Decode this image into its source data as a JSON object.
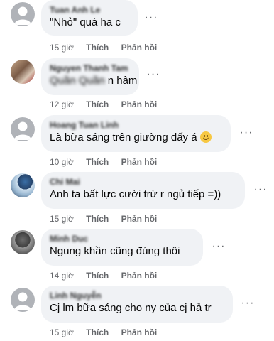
{
  "comments": [
    {
      "author": "Tuan Anh Le",
      "text": "\"Nhỏ\" quá ha c",
      "time": "15 giờ",
      "like": "Thích",
      "reply": "Phản hồi",
      "avatar": "default-avatar"
    },
    {
      "author": "Nguyen Thanh Tam",
      "text_prefix": "Quần Quần",
      "text": "n hâm",
      "time": "12 giờ",
      "like": "Thích",
      "reply": "Phản hồi",
      "avatar": "photo-avatar"
    },
    {
      "author": "Hoang Tuan Linh",
      "text": "Là bữa sáng trên giường đấy á",
      "emoji": "smiling-face-icon",
      "time": "10 giờ",
      "like": "Thích",
      "reply": "Phản hồi",
      "avatar": "default-avatar"
    },
    {
      "author": "Chi Mai",
      "text": "Anh ta bất lực cười trừ r ngủ tiếp =))",
      "time": "15 giờ",
      "like": "Thích",
      "reply": "Phản hồi",
      "avatar": "photo-avatar"
    },
    {
      "author": "Minh Duc",
      "text": "Ngung khần cũng đúng thôi",
      "time": "14 giờ",
      "like": "Thích",
      "reply": "Phản hồi",
      "avatar": "photo-avatar"
    },
    {
      "author": "Linh Nguyễn",
      "text": "Cj lm bữa sáng cho ny của cj hả tr",
      "time": "15 giờ",
      "like": "Thích",
      "reply": "Phản hồi",
      "avatar": "default-avatar"
    }
  ],
  "more_options": "···"
}
